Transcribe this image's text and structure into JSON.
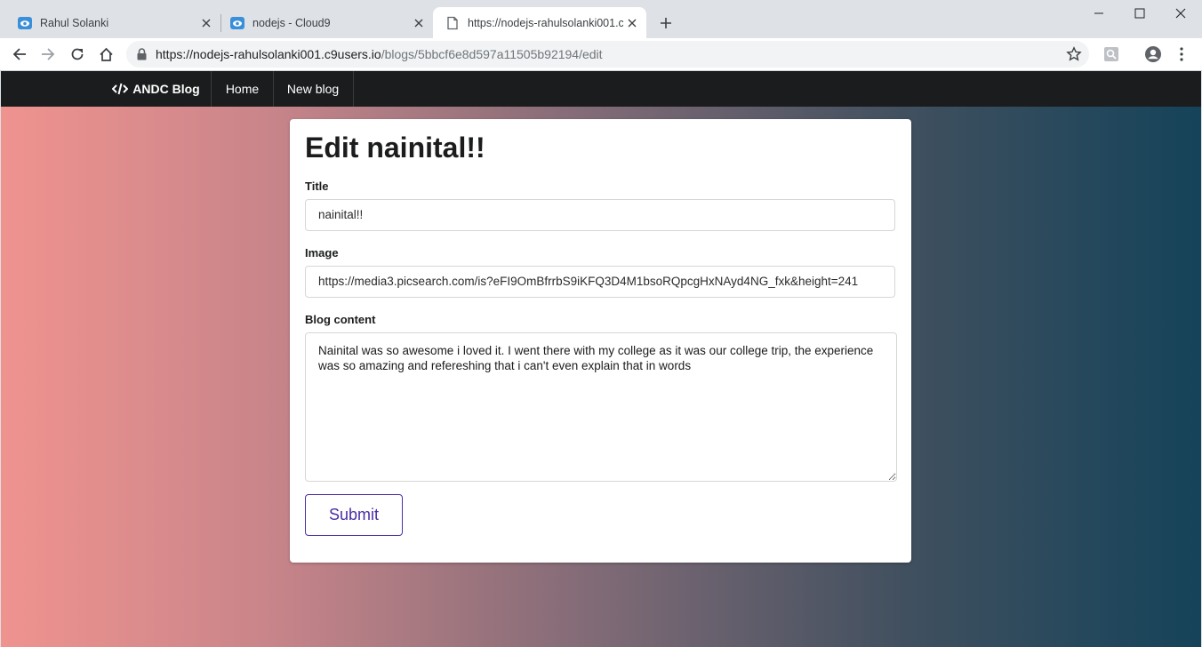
{
  "browser": {
    "tabs": [
      {
        "title": "Rahul Solanki",
        "favicon": "cloud9-icon",
        "active": false
      },
      {
        "title": "nodejs - Cloud9",
        "favicon": "cloud9-icon",
        "active": false
      },
      {
        "title": "https://nodejs-rahulsolanki001.c9users.io/blogs/5bbcf6e8d597a11505b92194/edit",
        "favicon": "page-icon",
        "active": true
      }
    ],
    "url_host": "https://nodejs-rahulsolanki001.c9users.io",
    "url_path": "/blogs/5bbcf6e8d597a11505b92194/edit"
  },
  "navbar": {
    "brand": "ANDC Blog",
    "items": [
      "Home",
      "New blog"
    ],
    "background": "#1b1c1d"
  },
  "form": {
    "heading": "Edit nainital!!",
    "title_label": "Title",
    "title_value": "nainital!!",
    "image_label": "Image",
    "image_value": "https://media3.picsearch.com/is?eFI9OmBfrrbS9iKFQ3D4M1bsoRQpcgHxNAyd4NG_fxk&height=241",
    "content_label": "Blog content",
    "content_value": "Nainital was so awesome i loved it. I went there with my college as it was our college trip, the experience was so amazing and refereshing that i can't even explain that in words",
    "submit_label": "Submit",
    "accent": "#4a2ea6"
  }
}
